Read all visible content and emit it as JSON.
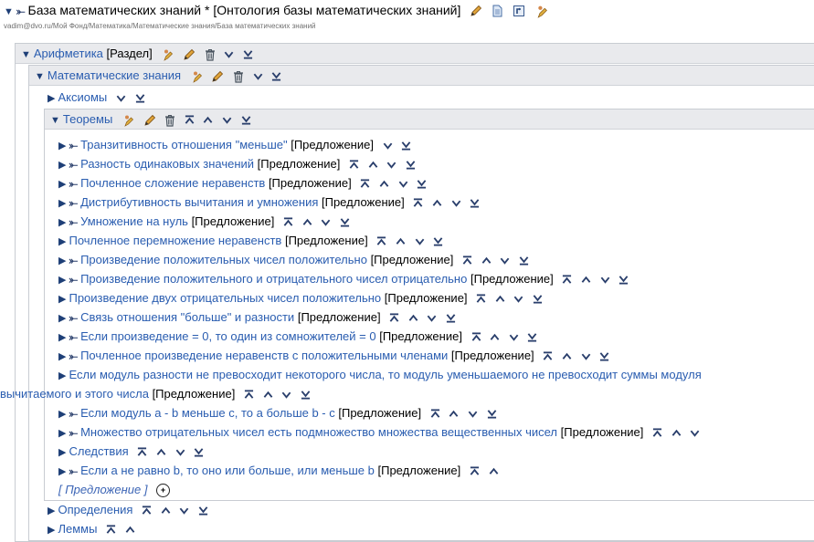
{
  "header": {
    "title": "База математических знаний * [Онтология базы математических знаний]",
    "path": "vadim@dvo.ru/Мой Фонд/Математика/Математические знания/База математических знаний"
  },
  "section": {
    "label": "Арифметика",
    "tag": "[Раздел]"
  },
  "subsection": {
    "label": "Математические знания"
  },
  "axioms": {
    "label": "Аксиомы"
  },
  "theorems": {
    "label": "Теоремы"
  },
  "items": [
    {
      "label": "Транзитивность отношения \"меньше\"",
      "tag": "[Предложение]"
    },
    {
      "label": "Разность одинаковых значений",
      "tag": "[Предложение]"
    },
    {
      "label": "Почленное сложение неравенств",
      "tag": "[Предложение]"
    },
    {
      "label": "Дистрибутивность вычитания и умножения",
      "tag": "[Предложение]"
    },
    {
      "label": "Умножение на нуль",
      "tag": "[Предложение]"
    },
    {
      "label": "Почленное перемножение неравенств",
      "tag": "[Предложение]"
    },
    {
      "label": "Произведение положительных чисел положительно",
      "tag": "[Предложение]"
    },
    {
      "label": "Произведение положительного и отрицательного чисел отрицательно",
      "tag": "[Предложение]"
    },
    {
      "label": "Произведение двух отрицательных чисел положительно",
      "tag": "[Предложение]"
    },
    {
      "label": "Связь отношения \"больше\" и разности",
      "tag": "[Предложение]"
    },
    {
      "label": "Если произведение = 0, то один из сомножителей = 0",
      "tag": "[Предложение]"
    },
    {
      "label": "Почленное произведение неравенств с положительными членами",
      "tag": "[Предложение]"
    },
    {
      "label": "Если модуль разности не превосходит некоторого числа, то модуль уменьшаемого не превосходит суммы модуля",
      "label2": "вычитаемого и этого числа",
      "tag": "[Предложение]"
    },
    {
      "label": "Если модуль a - b меньше c, то a больше b - c",
      "tag": "[Предложение]"
    },
    {
      "label": "Множество отрицательных чисел есть подмножество множества вещественных чисел",
      "tag": "[Предложение]"
    },
    {
      "label": "Следствия"
    },
    {
      "label": "Если a не равно b, то оно или больше, или меньше b",
      "tag": "[Предложение]"
    }
  ],
  "add_placeholder": "[ Предложение ]",
  "definitions": {
    "label": "Определения"
  },
  "lemmas": {
    "label": "Леммы"
  },
  "colors": {
    "link": "#2a5db0",
    "bar": "#e9eaed",
    "icon": "#2a3f6c"
  }
}
